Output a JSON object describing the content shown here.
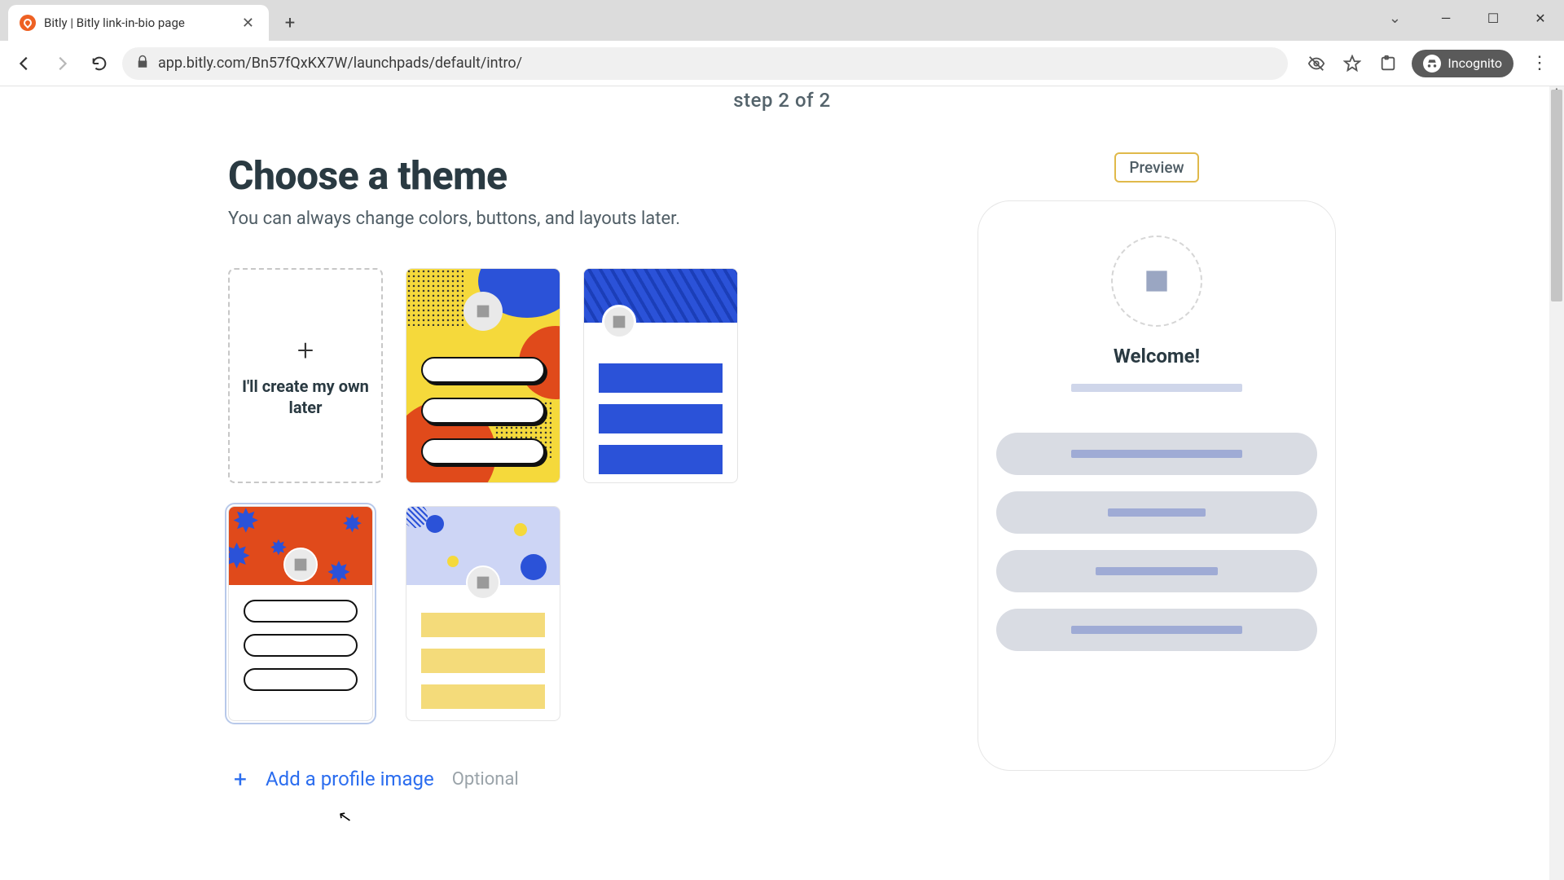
{
  "browser": {
    "tab_title": "Bitly | Bitly link-in-bio page",
    "url": "app.bitly.com/Bn57fQxKX7W/launchpads/default/intro/",
    "incognito_label": "Incognito"
  },
  "page": {
    "step_label": "step 2 of 2",
    "heading": "Choose a theme",
    "subheading": "You can always change colors, buttons, and layouts later.",
    "create_own_label": "I'll create my own later",
    "preview_badge": "Preview",
    "welcome_text": "Welcome!",
    "add_profile_label": "Add a profile image",
    "optional_label": "Optional"
  }
}
